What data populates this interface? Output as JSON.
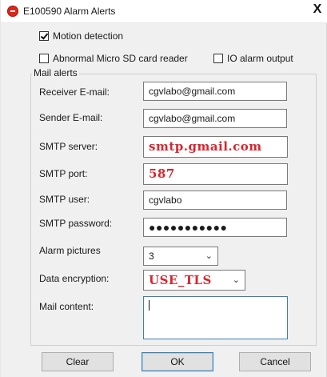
{
  "window": {
    "title": "E100590 Alarm Alerts",
    "close_glyph": "X",
    "icon": "app-record-icon"
  },
  "options": {
    "motion_detection": {
      "label": "Motion detection",
      "checked": true
    },
    "sd_card_reader": {
      "label": "Abnormal Micro SD card reader",
      "checked": false
    },
    "io_alarm_output": {
      "label": "IO alarm output",
      "checked": false
    }
  },
  "mail_alerts": {
    "group_label": "Mail alerts",
    "receiver": {
      "label": "Receiver E-mail:",
      "value": "cgvlabo@gmail.com"
    },
    "sender": {
      "label": "Sender E-mail:",
      "value": "cgvlabo@gmail.com"
    },
    "smtp_server": {
      "label": "SMTP server:",
      "value": "smtp.gmail.com"
    },
    "smtp_port": {
      "label": "SMTP port:",
      "value": "587"
    },
    "smtp_user": {
      "label": "SMTP user:",
      "value": "cgvlabo"
    },
    "smtp_password": {
      "label": "SMTP password:",
      "value": "●●●●●●●●●●●"
    },
    "alarm_pictures": {
      "label": "Alarm pictures",
      "value": "3"
    },
    "data_encryption": {
      "label": "Data encryption:",
      "value": "USE_TLS"
    },
    "mail_content": {
      "label": "Mail content:",
      "value": ""
    }
  },
  "buttons": {
    "clear": "Clear",
    "ok": "OK",
    "cancel": "Cancel"
  },
  "colors": {
    "highlight_text": "#d6262e",
    "focus_border": "#3c7fb1"
  }
}
